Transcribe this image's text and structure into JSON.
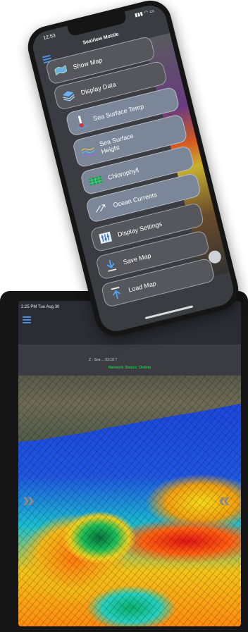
{
  "tablet": {
    "status_time": "2:25 PM   Tue Aug 30",
    "caption": "Z - Sea ...   03:18 ?",
    "network_status": "Network Status: Online",
    "chevron_left": "»",
    "chevron_right": "«"
  },
  "phone": {
    "status_time": "12:53",
    "status_icons": "▮▮▮ ◠ ▭",
    "app_title": "SeaView Mobile",
    "map_chevron": "«",
    "menu": [
      {
        "label": "Show Map",
        "icon": "map-icon",
        "style": "dark"
      },
      {
        "label": "Display Data",
        "icon": "layers-icon",
        "style": "dark"
      },
      {
        "label": "Sea Surface Temp",
        "icon": "thermometer-icon",
        "style": "light"
      },
      {
        "label": "Sea Surface Height",
        "icon": "wave-icon",
        "style": "light"
      },
      {
        "label": "Chlorophyll",
        "icon": "chlorophyll-icon",
        "style": "light"
      },
      {
        "label": "Ocean Currents",
        "icon": "currents-icon",
        "style": "light"
      },
      {
        "label": "Display Settings",
        "icon": "settings-icon",
        "style": "dark"
      },
      {
        "label": "Save Map",
        "icon": "download-icon",
        "style": "dark"
      },
      {
        "label": "Load Map",
        "icon": "upload-icon",
        "style": "dark"
      }
    ]
  },
  "colors": {
    "accent": "#4a90e2",
    "online": "#22c14a",
    "menu_dark": "#55575c",
    "menu_light": "#7b8799"
  }
}
